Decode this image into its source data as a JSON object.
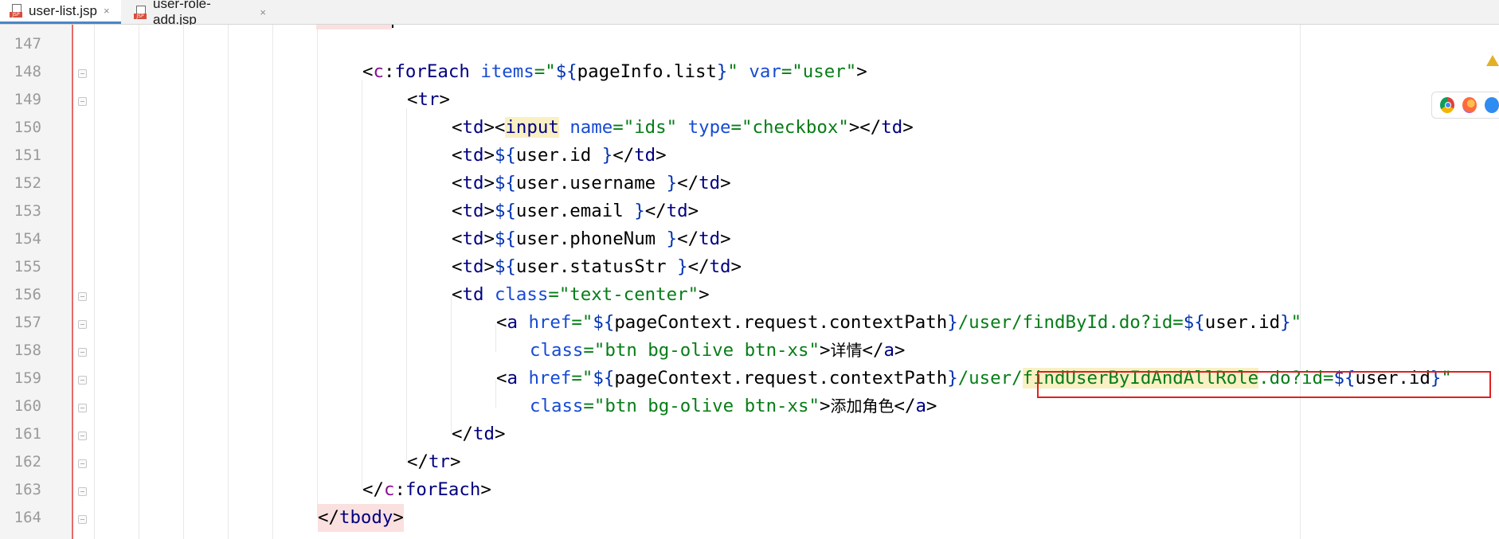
{
  "tabs": [
    {
      "label": "user-list.jsp",
      "icon": "jsp-file-icon",
      "active": true
    },
    {
      "label": "user-role-add.jsp",
      "icon": "jsp-file-icon",
      "active": false
    }
  ],
  "tab_close_glyph": "×",
  "file_icon_badge": "JSP",
  "line_numbers": [
    "147",
    "148",
    "149",
    "150",
    "151",
    "152",
    "153",
    "154",
    "155",
    "156",
    "157",
    "158",
    "159",
    "160",
    "161",
    "162",
    "163",
    "164"
  ],
  "code": {
    "l148": {
      "p1": "<",
      "ns": "c",
      "colon": ":",
      "tag": "forEach",
      "sp1": " ",
      "a1": "items",
      "eq1": "=",
      "q1": "\"",
      "el1": "${",
      "v1": "pageInfo.list",
      "el2": "}",
      "q2": "\"",
      "sp2": " ",
      "a2": "var",
      "eq2": "=",
      "s2": "\"user\"",
      "close": ">"
    },
    "l149": {
      "p1": "<",
      "tag": "tr",
      "close": ">"
    },
    "l150": {
      "p1": "<",
      "tag1": "td",
      "c1": "><",
      "tag2": "input",
      "sp1": " ",
      "a1": "name",
      "eq1": "=",
      "s1": "\"ids\"",
      "sp2": " ",
      "a2": "type",
      "eq2": "=",
      "s2": "\"checkbox\"",
      "c2": "></",
      "tag3": "td",
      "close": ">"
    },
    "l151": {
      "p1": "<",
      "tag1": "td",
      "c1": ">",
      "el1": "${",
      "v": "user.id ",
      "el2": "}",
      "c2": "</",
      "tag2": "td",
      "close": ">"
    },
    "l152": {
      "p1": "<",
      "tag1": "td",
      "c1": ">",
      "el1": "${",
      "v": "user.username ",
      "el2": "}",
      "c2": "</",
      "tag2": "td",
      "close": ">"
    },
    "l153": {
      "p1": "<",
      "tag1": "td",
      "c1": ">",
      "el1": "${",
      "v": "user.email ",
      "el2": "}",
      "c2": "</",
      "tag2": "td",
      "close": ">"
    },
    "l154": {
      "p1": "<",
      "tag1": "td",
      "c1": ">",
      "el1": "${",
      "v": "user.phoneNum ",
      "el2": "}",
      "c2": "</",
      "tag2": "td",
      "close": ">"
    },
    "l155": {
      "p1": "<",
      "tag1": "td",
      "c1": ">",
      "el1": "${",
      "v": "user.statusStr ",
      "el2": "}",
      "c2": "</",
      "tag2": "td",
      "close": ">"
    },
    "l156": {
      "p1": "<",
      "tag": "td",
      "sp": " ",
      "a": "class",
      "eq": "=",
      "s": "\"text-center\"",
      "close": ">"
    },
    "l157": {
      "p1": "<",
      "tag": "a",
      "sp": " ",
      "a": "href",
      "eq": "=",
      "q1": "\"",
      "el1": "${",
      "v1": "pageContext.request.contextPath",
      "el2": "}",
      "s1": "/user/findById.do?id=",
      "el3": "${",
      "v2": "user.id",
      "el4": "}",
      "q2": "\""
    },
    "l158": {
      "a": "class",
      "eq": "=",
      "s": "\"btn bg-olive btn-xs\"",
      "c1": ">",
      "text": "详情",
      "c2": "</",
      "tag": "a",
      "close": ">"
    },
    "l159": {
      "p1": "<",
      "tag": "a",
      "sp": " ",
      "a": "href",
      "eq": "=",
      "q1": "\"",
      "el1": "${",
      "v1": "pageContext.request.contextPath",
      "el2": "}",
      "s1": "/user/",
      "s2": "findUserByIdAndAllRole",
      "s3": ".do?id=",
      "el3": "${",
      "v2": "user.id",
      "el4": "}",
      "q2": "\""
    },
    "l160": {
      "a": "class",
      "eq": "=",
      "s": "\"btn bg-olive btn-xs\"",
      "c1": ">",
      "text": "添加角色",
      "c2": "</",
      "tag": "a",
      "close": ">"
    },
    "l161": {
      "p1": "</",
      "tag": "td",
      "close": ">"
    },
    "l162": {
      "p1": "</",
      "tag": "tr",
      "close": ">"
    },
    "l163": {
      "p1": "</",
      "ns": "c",
      "colon": ":",
      "tag": "forEach",
      "close": ">"
    },
    "l164": {
      "p1": "</",
      "tag": "tbody",
      "close": ">"
    }
  },
  "colors": {
    "tag": "#000080",
    "attribute": "#174ad4",
    "string": "#067d17",
    "el": "#0033b3",
    "namespace": "#871094",
    "annotation_box": "#e02020"
  },
  "right_toolbar": {
    "icons": [
      "chrome-icon",
      "firefox-icon",
      "safari-icon"
    ],
    "warning": "warning-icon"
  }
}
